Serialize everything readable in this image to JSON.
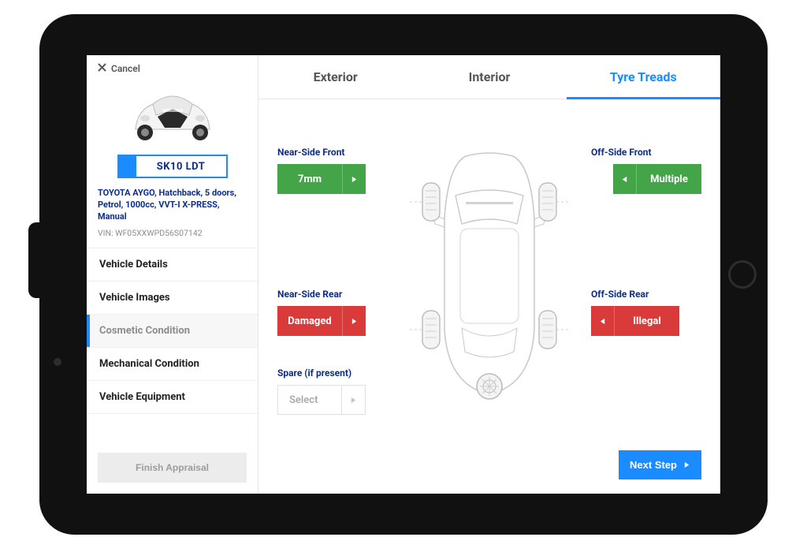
{
  "cancel_label": "Cancel",
  "reg_plate": "SK10 LDT",
  "vehicle_desc": "TOYOTA AYGO, Hatchback, 5 doors, Petrol, 1000cc, VVT-I X-PRESS, Manual",
  "vin_label": "VIN: WF05XXWPD56S07142",
  "sidebar": {
    "items": [
      {
        "label": "Vehicle Details"
      },
      {
        "label": "Vehicle Images"
      },
      {
        "label": "Cosmetic Condition"
      },
      {
        "label": "Mechanical Condition"
      },
      {
        "label": "Vehicle Equipment"
      }
    ]
  },
  "finish_label": "Finish Appraisal",
  "tabs": {
    "exterior": "Exterior",
    "interior": "Interior",
    "tyre_treads": "Tyre Treads"
  },
  "tyres": {
    "near_front": {
      "label": "Near-Side Front",
      "value": "7mm"
    },
    "off_front": {
      "label": "Off-Side Front",
      "value": "Multiple"
    },
    "near_rear": {
      "label": "Near-Side Rear",
      "value": "Damaged"
    },
    "off_rear": {
      "label": "Off-Side Rear",
      "value": "Illegal"
    },
    "spare": {
      "label": "Spare (if present)",
      "value": "Select"
    }
  },
  "next_step": "Next Step"
}
